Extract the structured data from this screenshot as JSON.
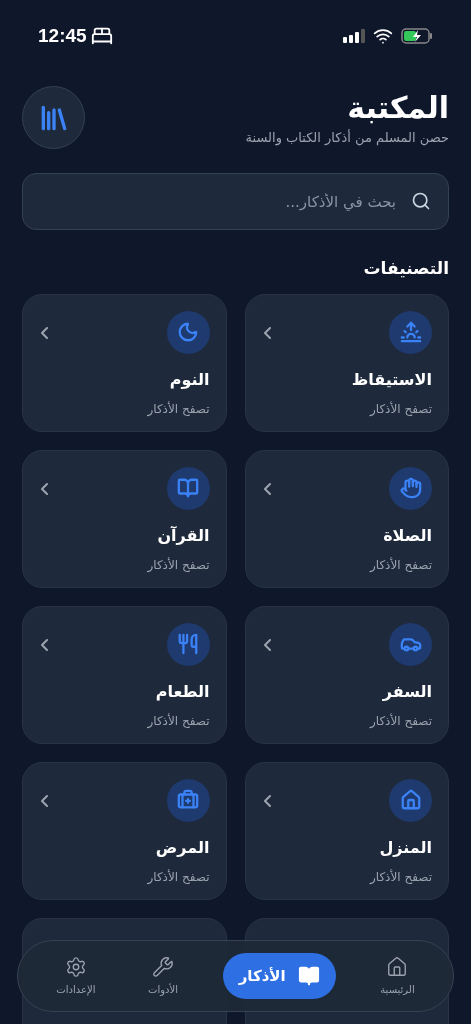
{
  "status_bar": {
    "time": "12:45"
  },
  "header": {
    "title": "المكتبة",
    "subtitle": "حصن المسلم من أذكار الكتاب والسنة"
  },
  "search": {
    "placeholder": "بحث في الأذكار..."
  },
  "section_title": "التصنيفات",
  "categories": [
    {
      "title": "الاستيقاظ",
      "subtitle": "تصفح الأذكار"
    },
    {
      "title": "النوم",
      "subtitle": "تصفح الأذكار"
    },
    {
      "title": "الصلاة",
      "subtitle": "تصفح الأذكار"
    },
    {
      "title": "القرآن",
      "subtitle": "تصفح الأذكار"
    },
    {
      "title": "السفر",
      "subtitle": "تصفح الأذكار"
    },
    {
      "title": "الطعام",
      "subtitle": "تصفح الأذكار"
    },
    {
      "title": "المنزل",
      "subtitle": "تصفح الأذكار"
    },
    {
      "title": "المرض",
      "subtitle": "تصفح الأذكار"
    }
  ],
  "nav": [
    {
      "label": "الرئيسية",
      "selected": false
    },
    {
      "label": "الأذكار",
      "selected": true
    },
    {
      "label": "الأدوات",
      "selected": false
    },
    {
      "label": "الإعدادات",
      "selected": false
    }
  ]
}
